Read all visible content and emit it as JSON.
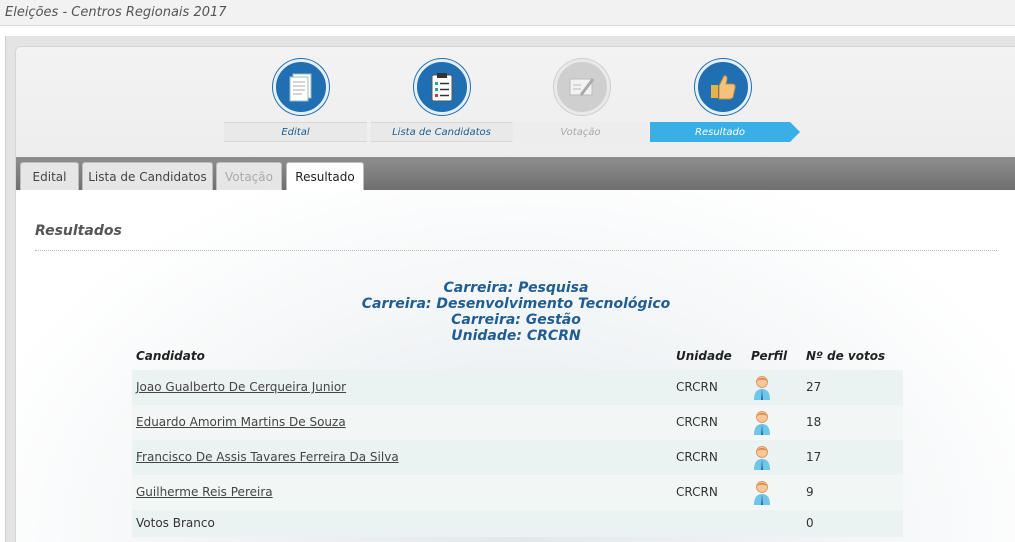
{
  "window": {
    "title": "Eleições - Centros Regionais 2017"
  },
  "steps": [
    {
      "label": "Edital",
      "state": "done",
      "icon": "document-icon"
    },
    {
      "label": "Lista de Candidatos",
      "state": "done",
      "icon": "clipboard-list-icon"
    },
    {
      "label": "Votação",
      "state": "disabled",
      "icon": "ballot-icon"
    },
    {
      "label": "Resultado",
      "state": "current",
      "icon": "thumbs-up-icon"
    }
  ],
  "tabs": [
    {
      "label": "Edital",
      "state": "normal"
    },
    {
      "label": "Lista de Candidatos",
      "state": "normal"
    },
    {
      "label": "Votação",
      "state": "disabled"
    },
    {
      "label": "Resultado",
      "state": "selected"
    }
  ],
  "section": {
    "title": "Resultados"
  },
  "headings": [
    "Carreira: Pesquisa",
    "Carreira: Desenvolvimento Tecnológico",
    "Carreira: Gestão",
    "Unidade: CRCRN"
  ],
  "table": {
    "columns": [
      "Candidato",
      "Unidade",
      "Perfil",
      "Nº de votos"
    ],
    "rows": [
      {
        "candidato": "Joao Gualberto De Cerqueira Junior",
        "unidade": "CRCRN",
        "perfil": "person-avatar-icon",
        "votos": "27"
      },
      {
        "candidato": "Eduardo Amorim Martins De Souza",
        "unidade": "CRCRN",
        "perfil": "person-avatar-icon",
        "votos": "18"
      },
      {
        "candidato": "Francisco De Assis Tavares Ferreira Da Silva",
        "unidade": "CRCRN",
        "perfil": "person-avatar-icon",
        "votos": "17"
      },
      {
        "candidato": "Guilherme Reis Pereira",
        "unidade": "CRCRN",
        "perfil": "person-avatar-icon",
        "votos": "9"
      },
      {
        "candidato": "Votos Branco",
        "unidade": "",
        "perfil": "",
        "votos": "0"
      }
    ]
  },
  "colors": {
    "step_active": "#1f6fb2",
    "step_current_bar": "#3aaee6",
    "heading_text": "#1f5d93",
    "row_bg": "#eaf3f1"
  }
}
